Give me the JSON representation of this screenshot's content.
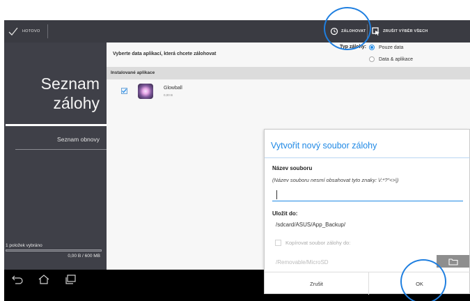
{
  "topbar": {
    "done_label": "HOTOVO",
    "backup_label": "ZÁLOHOVAT",
    "deselect_label": "ZRUŠIT VÝBĚR VŠECH"
  },
  "sidebar": {
    "title_line1": "Seznam",
    "title_line2": "zálohy",
    "restore_label": "Seznam obnovy",
    "selected_count": "1 položek vybráno",
    "size_used": "0,00 B / 600 MB"
  },
  "main": {
    "heading": "Vyberte data aplikací, která chcete zálohovat",
    "backup_type_label": "Typ zálohy:",
    "backup_type_options": [
      "Pouze data",
      "Data & aplikace"
    ],
    "selected_backup_type": "Pouze data",
    "section_label": "Instalované aplikace",
    "apps": [
      {
        "name": "Glowball",
        "size": "0,00 B",
        "checked": true
      }
    ]
  },
  "dialog": {
    "title": "Vytvořit nový soubor zálohy",
    "filename_label": "Název souboru",
    "filename_hint": "(Název souboru nesmí obsahovat tyto znaky: \\/:*?\"<>|)",
    "filename_value": "",
    "save_to_label": "Uložit do:",
    "save_path": "/sdcard/ASUS/App_Backup/",
    "copy_label": "Kopírovat soubor zálohy do:",
    "copy_path": "/Removable/MicroSD",
    "cancel_label": "Zrušit",
    "ok_label": "OK"
  },
  "colors": {
    "accent": "#1e88e5",
    "sidebar_bg": "#3f4048",
    "actionbar_bg": "#3a3b42",
    "highlight_circle": "#1f7fe0"
  },
  "icons": {
    "done": "checkmark-icon",
    "backup": "backup-clock-icon",
    "deselect": "deselect-all-icon",
    "back": "back-arrow-icon",
    "home": "home-icon",
    "recents": "recent-apps-icon",
    "folder": "folder-icon"
  }
}
